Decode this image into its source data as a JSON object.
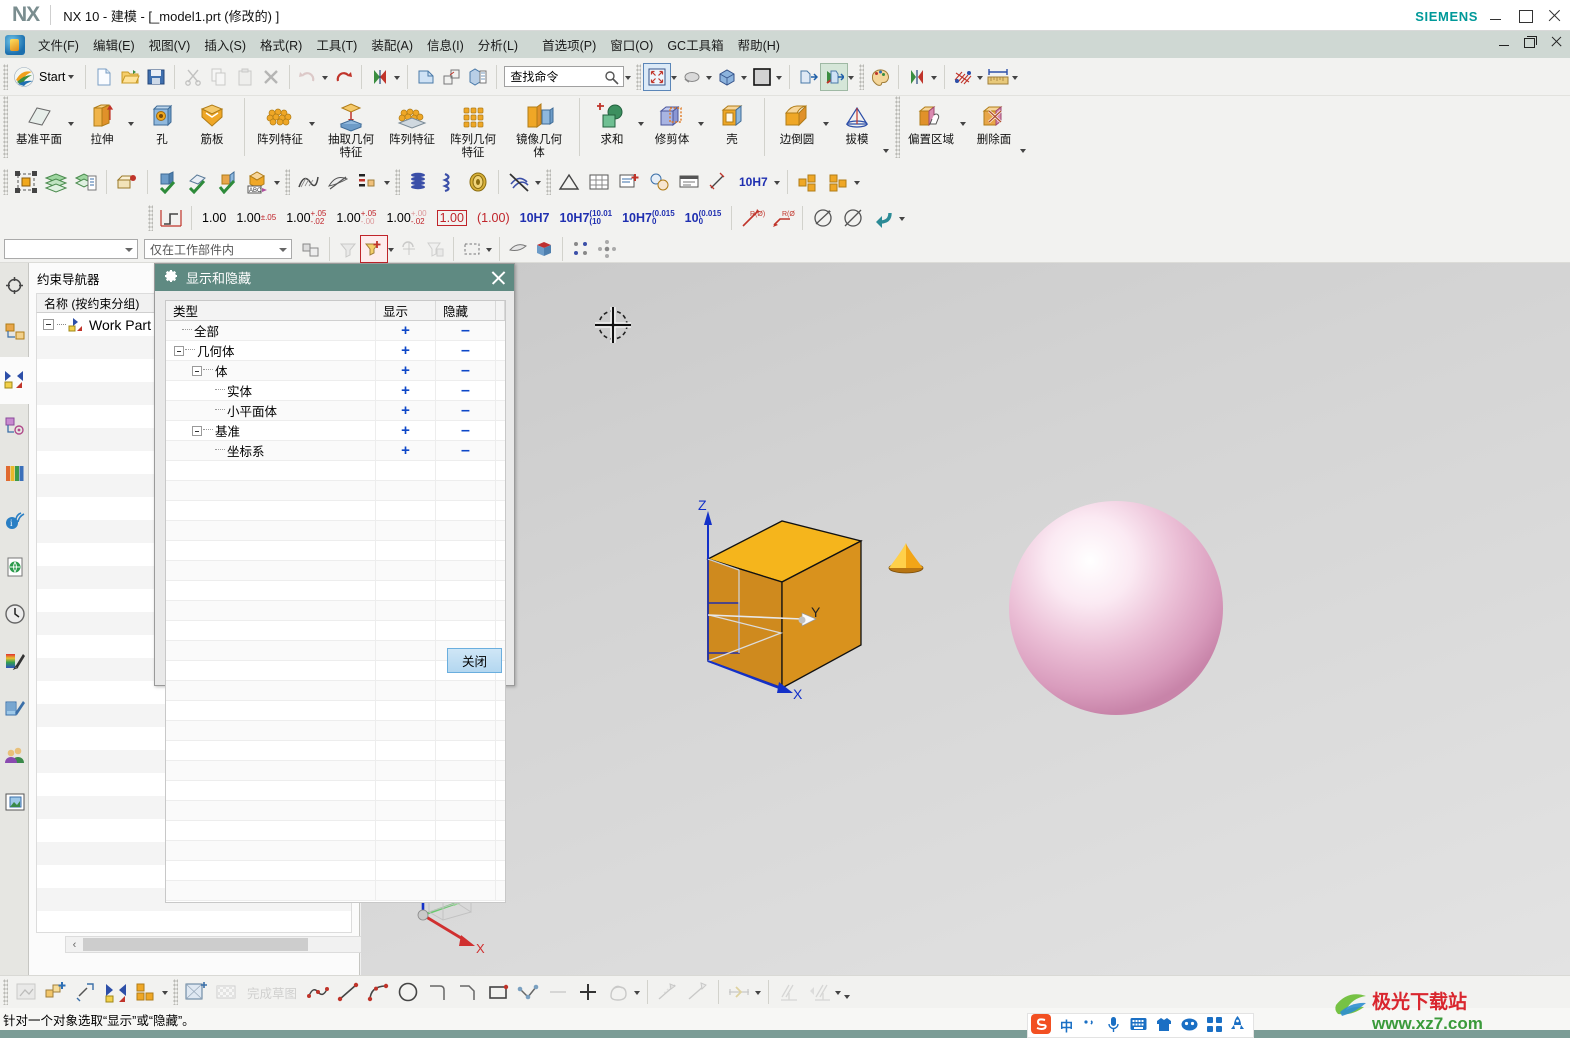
{
  "window": {
    "logo": "NX",
    "title": "NX 10 - 建模 - [_model1.prt  (修改的)  ]",
    "brand": "SIEMENS",
    "minimize": "minimize",
    "maximize": "maximize",
    "close": "close"
  },
  "menubar": {
    "items": [
      {
        "label": "文件(F)"
      },
      {
        "label": "编辑(E)"
      },
      {
        "label": "视图(V)"
      },
      {
        "label": "插入(S)"
      },
      {
        "label": "格式(R)"
      },
      {
        "label": "工具(T)"
      },
      {
        "label": "装配(A)"
      },
      {
        "label": "信息(I)"
      },
      {
        "label": "分析(L)"
      },
      {
        "label": "首选项(P)"
      },
      {
        "label": "窗口(O)"
      },
      {
        "label": "GC工具箱"
      },
      {
        "label": "帮助(H)"
      }
    ]
  },
  "quick_access": {
    "start_label": "Start",
    "search_placeholder": "查找命令",
    "icons": [
      "new-file-icon",
      "open-folder-icon",
      "save-icon",
      "cut-icon",
      "copy-icon",
      "paste-icon",
      "delete-icon",
      "undo-icon",
      "redo-icon",
      "reverse-icon",
      "transparency-icon",
      "wireframe-icon",
      "section-icon"
    ]
  },
  "ribbon": {
    "groups": [
      {
        "buttons": [
          {
            "label": "基准平面",
            "icon": "datum-plane-icon",
            "has_caret": true
          },
          {
            "label": "拉伸",
            "icon": "extrude-icon",
            "has_caret": true
          },
          {
            "label": "孔",
            "icon": "hole-icon",
            "has_caret": false
          },
          {
            "label": "筋板",
            "icon": "rib-icon",
            "has_caret": false
          }
        ]
      },
      {
        "buttons": [
          {
            "label": "阵列特征",
            "icon": "pattern-feature-icon",
            "has_caret": true
          },
          {
            "label": "抽取几何特征",
            "icon": "extract-geometry-icon",
            "has_caret": false
          },
          {
            "label": "阵列特征",
            "icon": "pattern-feature-2-icon",
            "has_caret": false
          },
          {
            "label": "阵列几何特征",
            "icon": "pattern-geometry-icon",
            "has_caret": false
          },
          {
            "label": "镜像几何体",
            "icon": "mirror-geometry-icon",
            "has_caret": false
          }
        ]
      },
      {
        "buttons": [
          {
            "label": "求和",
            "icon": "unite-icon",
            "has_caret": true
          },
          {
            "label": "修剪体",
            "icon": "trim-body-icon",
            "has_caret": true
          },
          {
            "label": "壳",
            "icon": "shell-icon",
            "has_caret": false
          }
        ]
      },
      {
        "buttons": [
          {
            "label": "边倒圆",
            "icon": "edge-blend-icon",
            "has_caret": true
          },
          {
            "label": "拔模",
            "icon": "draft-icon",
            "has_caret": false
          }
        ]
      },
      {
        "buttons": [
          {
            "label": "偏置区域",
            "icon": "offset-region-icon",
            "has_caret": true
          },
          {
            "label": "删除面",
            "icon": "delete-face-icon",
            "has_caret": false
          }
        ]
      }
    ]
  },
  "dimension_toolbar": {
    "items": [
      {
        "label": "1.00",
        "name": "dim-plain"
      },
      {
        "label": "1.00",
        "sub_top": "±.05",
        "name": "dim-symmetric"
      },
      {
        "label": "1.00",
        "sub_top": "+.05",
        "sub_bot": "-.02",
        "name": "dim-bilateral"
      },
      {
        "label": "1.00",
        "sub_top": "+.05",
        "sub_bot": "-.00",
        "name": "dim-unilateral-up"
      },
      {
        "label": "1.00",
        "sub_top": "+.00",
        "sub_bot": "-.02",
        "name": "dim-unilateral-down"
      },
      {
        "label": "1.00",
        "name": "dim-basic-boxed"
      },
      {
        "label": "(1.00)",
        "name": "dim-reference"
      },
      {
        "label": "10H7",
        "name": "dim-fit"
      },
      {
        "label": "10H7",
        "sub_top": "(10.01",
        "sub_bot": "(10",
        "name": "dim-fit-limits"
      },
      {
        "label": "10H7",
        "sub_top": "(0.015",
        "sub_bot": "0",
        "name": "dim-fit-dev"
      },
      {
        "label": "10",
        "sub_top": "(0.015",
        "sub_bot": "0",
        "name": "dim-dev-only"
      }
    ]
  },
  "selection_bar": {
    "filter_value": "",
    "scope_value": "仅在工作部件内"
  },
  "resource_bar": {
    "items": [
      {
        "name": "assembly-navigator-icon"
      },
      {
        "name": "constraint-navigator-icon"
      },
      {
        "name": "part-navigator-icon"
      },
      {
        "name": "reuse-library-icon"
      },
      {
        "name": "hd3d-tools-icon"
      },
      {
        "name": "web-browser-icon"
      },
      {
        "name": "history-icon"
      },
      {
        "name": "system-materials-icon"
      },
      {
        "name": "system-scenes-icon"
      },
      {
        "name": "roles-icon"
      },
      {
        "name": "view-icon"
      }
    ]
  },
  "navigator": {
    "title": "约束导航器",
    "column_header": "名称 (按约束分组)",
    "root_item": "Work Part",
    "scroll_left_arrow": "‹",
    "scroll_right_arrow": "›"
  },
  "dialog": {
    "title": "显示和隐藏",
    "gear_icon": "gear-icon",
    "close_icon": "close-icon",
    "columns": {
      "type": "类型",
      "show": "显示",
      "hide": "隐藏"
    },
    "show_glyph": "+",
    "hide_glyph": "–",
    "rows": [
      {
        "label": "全部",
        "level": 1,
        "expander": false
      },
      {
        "label": "几何体",
        "level": 0,
        "expander": true
      },
      {
        "label": "体",
        "level": 1,
        "expander": true
      },
      {
        "label": "实体",
        "level": 2,
        "expander": false
      },
      {
        "label": "小平面体",
        "level": 2,
        "expander": false
      },
      {
        "label": "基准",
        "level": 1,
        "expander": true
      },
      {
        "label": "坐标系",
        "level": 2,
        "expander": false
      }
    ],
    "close_button": "关闭"
  },
  "viewport": {
    "axis_x": "X",
    "axis_y": "Y",
    "axis_z": "Z",
    "wcs_x": "X",
    "wcs_y": "Y",
    "wcs_z": "Z",
    "cursor": "crosshair-cursor",
    "objects": [
      {
        "name": "block-body",
        "color": "#E8A021"
      },
      {
        "name": "cone-body",
        "color": "#F2A517"
      },
      {
        "name": "sphere-body",
        "color": "#E9BCD4"
      }
    ]
  },
  "bottom_toolbar": {
    "finish_sketch_label": "完成草图",
    "icons": [
      "sketch-in-task-icon",
      "create-sketch-icon",
      "sketch-point-icon",
      "mirror-curve-icon",
      "pattern-curve-icon",
      "sketch-wizard-icon",
      "finish-sketch-icon",
      "studio-spline-icon",
      "line-icon",
      "arc-icon",
      "circle-icon",
      "fillet-icon",
      "chamfer-icon",
      "rectangle-icon",
      "polygon-icon",
      "point-icon",
      "profile-icon",
      "trim-curve-icon",
      "extend-curve-icon",
      "quick-trim-icon",
      "geometric-constraint-icon",
      "auto-constraint-icon"
    ]
  },
  "status_bar": {
    "message": "针对一个对象选取“显示”或“隐藏”。"
  },
  "tray": {
    "items": [
      "sogou-logo",
      "中",
      "punctuation",
      "microphone-icon",
      "keyboard-icon",
      "shirt-icon",
      "emoji-icon",
      "apps-icon",
      "rocket-icon"
    ]
  },
  "watermark": {
    "title": "极光下载站",
    "url": "www.xz7.com"
  },
  "colors": {
    "dialog_header": "#5f8a82",
    "menubar": "#cfd8d3",
    "siemens_teal": "#009999",
    "tree_blue": "#0d47c8",
    "block_orange": "#E8A021",
    "sphere_pink": "#E9BCD4"
  }
}
